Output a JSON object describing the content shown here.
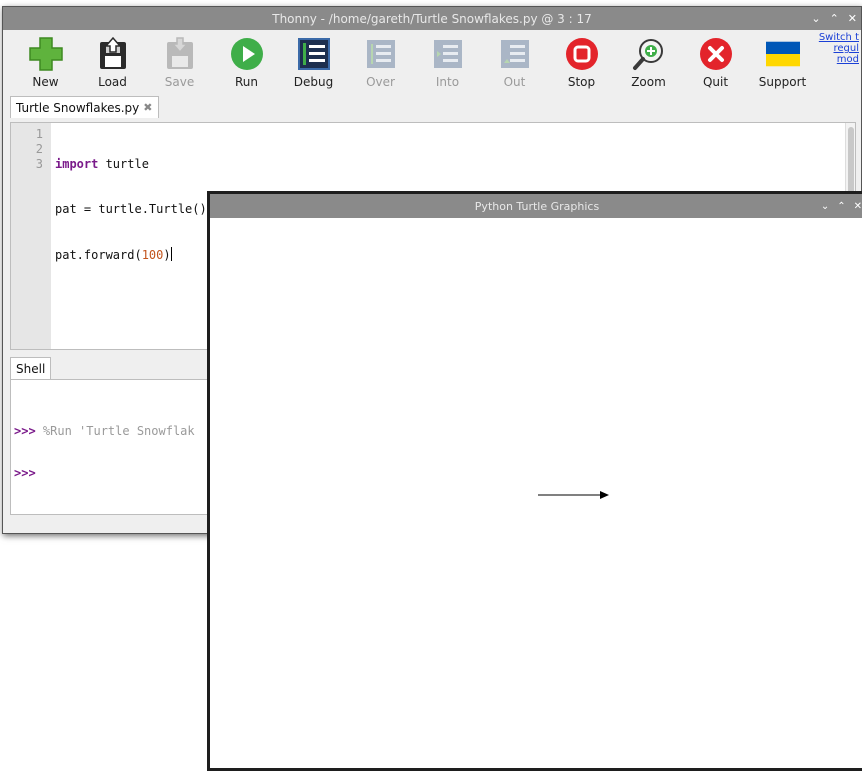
{
  "thonny": {
    "title": "Thonny  -  /home/gareth/Turtle Snowflakes.py  @  3 : 17",
    "controls": [
      "⌄",
      "⌃",
      "✕"
    ],
    "toolbar": [
      {
        "label": "New",
        "icon": "new-icon",
        "enabled": true
      },
      {
        "label": "Load",
        "icon": "load-icon",
        "enabled": true
      },
      {
        "label": "Save",
        "icon": "save-icon",
        "enabled": false
      },
      {
        "label": "Run",
        "icon": "run-icon",
        "enabled": true
      },
      {
        "label": "Debug",
        "icon": "debug-icon",
        "enabled": true
      },
      {
        "label": "Over",
        "icon": "step-over-icon",
        "enabled": false
      },
      {
        "label": "Into",
        "icon": "step-into-icon",
        "enabled": false
      },
      {
        "label": "Out",
        "icon": "step-out-icon",
        "enabled": false
      },
      {
        "label": "Stop",
        "icon": "stop-icon",
        "enabled": true
      },
      {
        "label": "Zoom",
        "icon": "zoom-icon",
        "enabled": true
      },
      {
        "label": "Quit",
        "icon": "quit-icon",
        "enabled": true
      },
      {
        "label": "Support",
        "icon": "ukraine-flag-icon",
        "enabled": true
      }
    ],
    "switch_link": [
      "Switch t",
      "regul",
      "mod"
    ],
    "editor_tab": {
      "label": "Turtle Snowflakes.py",
      "close": "✖"
    },
    "editor": {
      "line_numbers": [
        "1",
        "2",
        "3"
      ],
      "lines": [
        {
          "kw": "import",
          "rest": " turtle"
        },
        {
          "text": "pat = turtle.Turtle()"
        },
        {
          "pre": "pat.forward(",
          "num": "100",
          "post": ")"
        }
      ]
    },
    "shell_tab": "Shell",
    "shell": {
      "prompt": ">>>",
      "run_command": " %Run 'Turtle Snowflak"
    }
  },
  "turtle_window": {
    "title": "Python Turtle Graphics",
    "controls": [
      "⌄",
      "⌃",
      "✕"
    ]
  },
  "colors": {
    "titlebar": "#8a8a8a",
    "keyword": "#7a1a8a",
    "number": "#c2541d",
    "link": "#1a3fd6"
  }
}
